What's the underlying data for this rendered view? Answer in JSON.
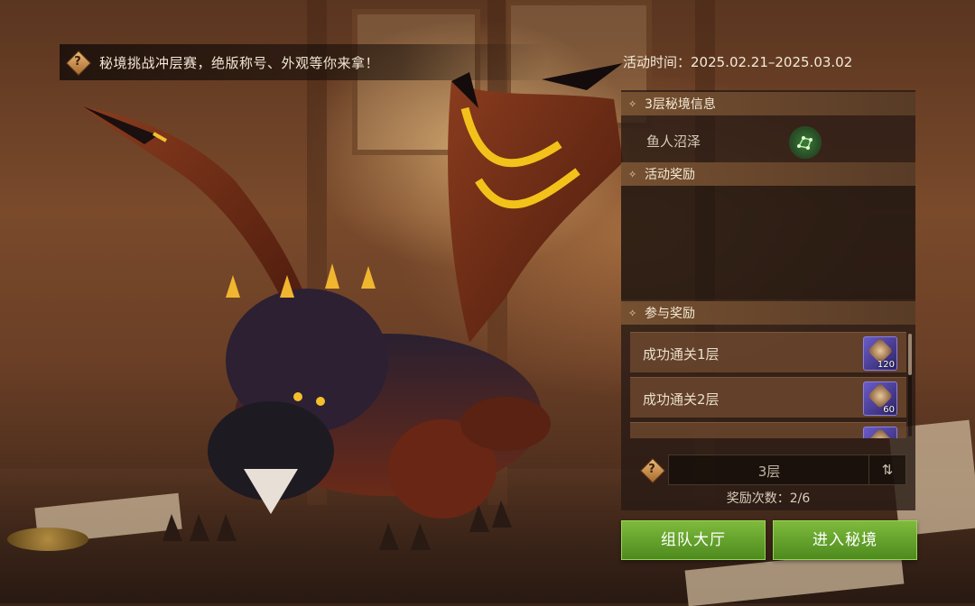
{
  "banner": {
    "text": "秘境挑战冲层赛，绝版称号、外观等你来拿！",
    "help_icon": "question-icon"
  },
  "event_time": "活动时间：2025.02.21–2025.03.02",
  "panel": {
    "dungeon_info_title": "3层秘境信息",
    "dungeon_name": "鱼人沼泽",
    "activity_rewards_title": "活动奖励",
    "participation_title": "参与奖励",
    "participation_items": [
      {
        "label": "成功通关1层",
        "reward_count": "120"
      },
      {
        "label": "成功通关2层",
        "reward_count": "60"
      }
    ],
    "floor_value": "3层",
    "reward_count_text": "奖励次数：2/6"
  },
  "buttons": {
    "team_hall": "组队大厅",
    "enter_dungeon": "进入秘境"
  },
  "colors": {
    "button_green": "#5e9c26",
    "panel_header": "#785232",
    "reward_frame": "#4a3e9a"
  }
}
